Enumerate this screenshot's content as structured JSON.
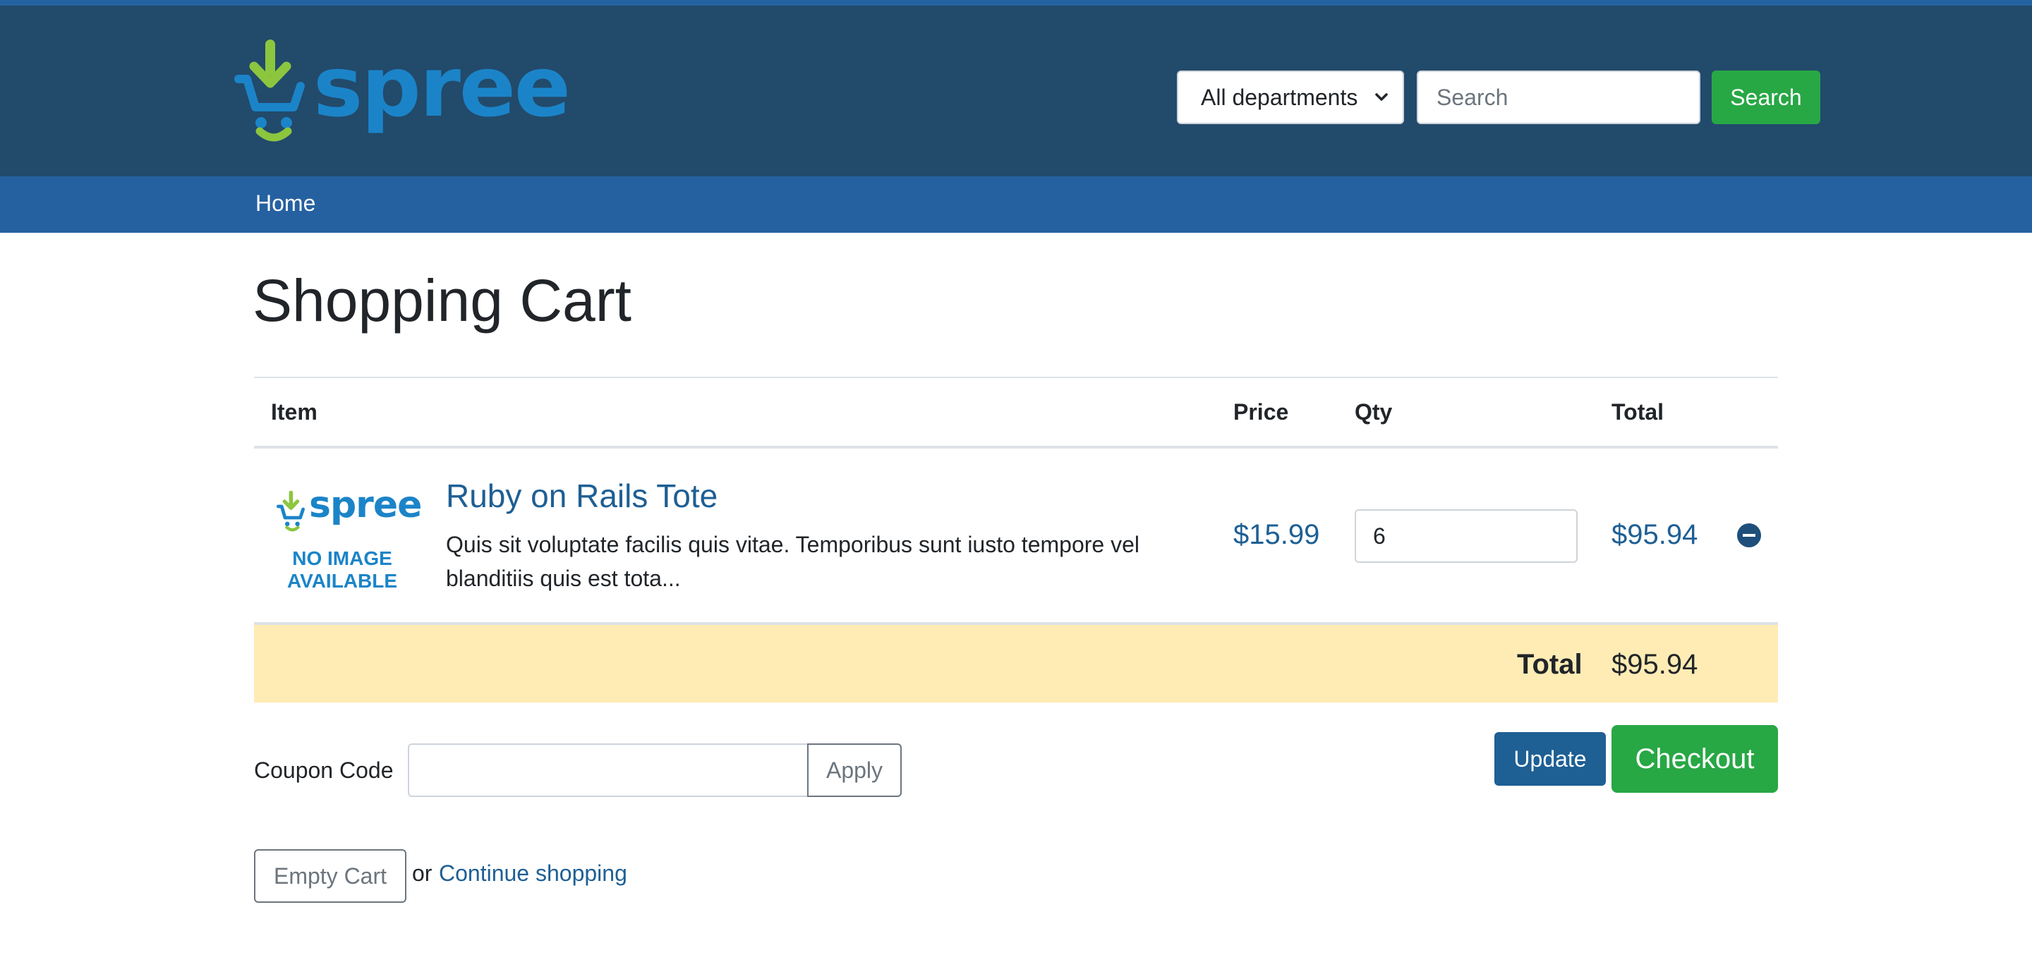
{
  "header": {
    "logo_text": "spree",
    "department_select": {
      "selected": "All departments"
    },
    "search": {
      "placeholder": "Search",
      "button_label": "Search"
    }
  },
  "nav": {
    "items": [
      {
        "label": "Home"
      }
    ]
  },
  "page": {
    "title": "Shopping Cart"
  },
  "cart": {
    "columns": {
      "item": "Item",
      "price": "Price",
      "qty": "Qty",
      "total": "Total"
    },
    "items": [
      {
        "image": {
          "logo_text": "spree",
          "no_image_line1": "NO IMAGE",
          "no_image_line2": "AVAILABLE"
        },
        "name": "Ruby on Rails Tote",
        "description": "Quis sit voluptate facilis quis vitae. Temporibus sunt iusto tempore vel blanditiis quis est tota...",
        "price": "$15.99",
        "quantity": "6",
        "total": "$95.94"
      }
    ],
    "summary": {
      "label": "Total",
      "value": "$95.94"
    }
  },
  "coupon": {
    "label": "Coupon Code",
    "value": "",
    "apply_label": "Apply"
  },
  "actions": {
    "update_label": "Update",
    "checkout_label": "Checkout",
    "empty_cart_label": "Empty Cart",
    "or_text": "or",
    "continue_label": "Continue shopping"
  },
  "colors": {
    "header_bg": "#224a6b",
    "nav_bg": "#2561a0",
    "brand_blue": "#1b84c8",
    "brand_green": "#8cc63f",
    "link": "#1e5f94",
    "success": "#28a745",
    "total_row_bg": "#ffecb5"
  },
  "icons": [
    "spree-cart-logo-icon",
    "chevron-down-icon",
    "remove-item-icon"
  ]
}
